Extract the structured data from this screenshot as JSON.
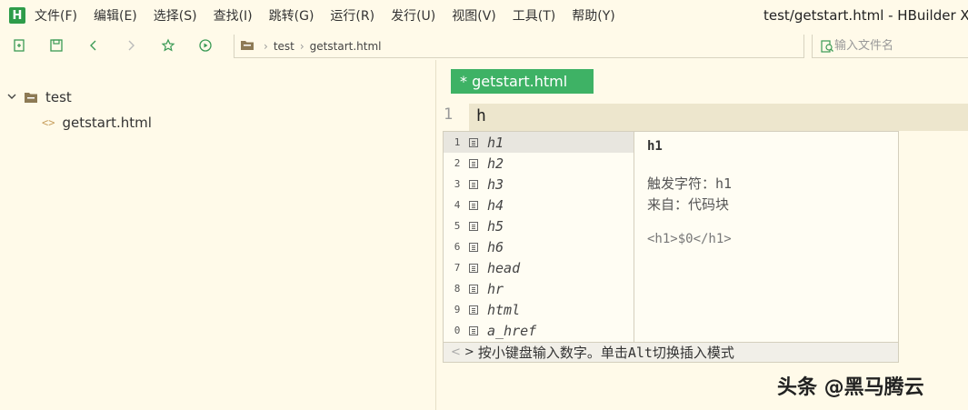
{
  "app": {
    "logo_letter": "H",
    "window_title": "test/getstart.html - HBuilder X"
  },
  "menu": [
    "文件(F)",
    "编辑(E)",
    "选择(S)",
    "查找(I)",
    "跳转(G)",
    "运行(R)",
    "发行(U)",
    "视图(V)",
    "工具(T)",
    "帮助(Y)"
  ],
  "toolbar": {
    "icons": [
      "new-file-icon",
      "save-icon",
      "back-icon",
      "forward-icon",
      "favorite-icon",
      "run-icon"
    ],
    "breadcrumb": [
      "test",
      "getstart.html"
    ],
    "file_search_placeholder": "输入文件名"
  },
  "sidebar": {
    "root": {
      "label": "test",
      "expanded": true
    },
    "child": {
      "label": "getstart.html"
    }
  },
  "editor": {
    "tab_label": "* getstart.html",
    "line_number": "1",
    "line_text": "h"
  },
  "completion": {
    "items": [
      {
        "num": "1",
        "label": "h1"
      },
      {
        "num": "2",
        "label": "h2"
      },
      {
        "num": "3",
        "label": "h3"
      },
      {
        "num": "4",
        "label": "h4"
      },
      {
        "num": "5",
        "label": "h5"
      },
      {
        "num": "6",
        "label": "h6"
      },
      {
        "num": "7",
        "label": "head"
      },
      {
        "num": "8",
        "label": "hr"
      },
      {
        "num": "9",
        "label": "html"
      },
      {
        "num": "0",
        "label": "a_href"
      }
    ],
    "selected_index": 0,
    "detail": {
      "title": "h1",
      "trigger": "触发字符：h1",
      "source": "来自：代码块",
      "snippet": "<h1>$0</h1>"
    },
    "footer_hint": "按小键盘输入数字。单击Alt切换插入模式"
  },
  "watermark": "头条 @黑马腾云"
}
